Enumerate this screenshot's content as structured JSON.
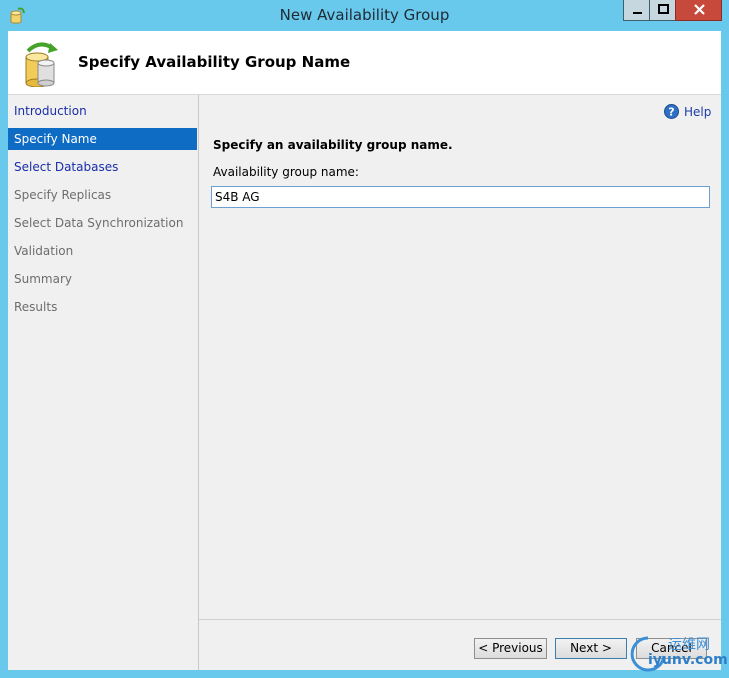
{
  "window": {
    "title": "New Availability Group",
    "controls": [
      "minimize-icon",
      "maximize-icon",
      "close-icon"
    ]
  },
  "header": {
    "title": "Specify Availability Group Name",
    "icon": "database-sync-icon"
  },
  "nav": {
    "items": [
      {
        "label": "Introduction",
        "state": "link"
      },
      {
        "label": "Specify Name",
        "state": "selected"
      },
      {
        "label": "Select Databases",
        "state": "link"
      },
      {
        "label": "Specify Replicas",
        "state": "disabled"
      },
      {
        "label": "Select Data Synchronization",
        "state": "disabled"
      },
      {
        "label": "Validation",
        "state": "disabled"
      },
      {
        "label": "Summary",
        "state": "disabled"
      },
      {
        "label": "Results",
        "state": "disabled"
      }
    ]
  },
  "main": {
    "help_label": "Help",
    "instruction": "Specify an availability group name.",
    "field_label": "Availability group name:",
    "field_value": "S4B AG"
  },
  "buttons": {
    "previous": "< Previous",
    "next": "Next >",
    "cancel": "Cancel"
  },
  "watermark": {
    "line1": "运维网",
    "line2": "iyunv.com"
  },
  "colors": {
    "frame": "#69c9ec",
    "selected": "#0f6cc4",
    "link": "#1a2ea8",
    "close": "#c7493b"
  }
}
